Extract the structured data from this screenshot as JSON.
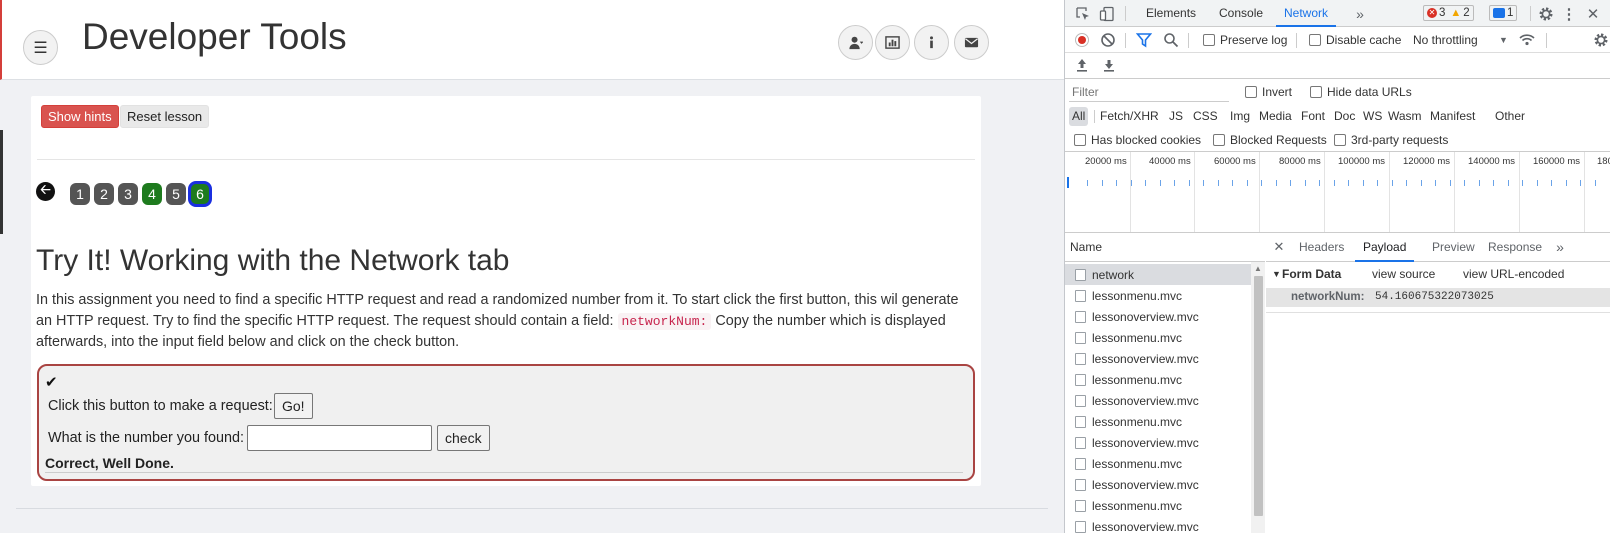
{
  "app": {
    "title": "Developer Tools"
  },
  "lesson": {
    "show_hints_label": "Show hints",
    "reset_label": "Reset lesson",
    "pages": [
      "1",
      "2",
      "3",
      "4",
      "5",
      "6"
    ],
    "title": "Try It! Working with the Network tab",
    "description_part1": "In this assignment you need to find a specific HTTP request and read a randomized number from it. To start click the first button, this wil generate an HTTP request. Try to find the specific HTTP request. The request should contain a field:",
    "description_code": "networkNum:",
    "description_part2": "Copy the number which is displayed afterwards, into the input field below and click on the check button.",
    "request_label": "Click this button to make a request:",
    "go_label": "Go!",
    "number_label": "What is the number you found:",
    "number_value": "",
    "check_label": "check",
    "feedback": "Correct, Well Done."
  },
  "devtools": {
    "tabs": [
      "Elements",
      "Console",
      "Network"
    ],
    "active_tab": "Network",
    "errors_count": "3",
    "warnings_count": "2",
    "messages_count": "1",
    "preserve_log_label": "Preserve log",
    "disable_cache_label": "Disable cache",
    "throttling_label": "No throttling",
    "filter_placeholder": "Filter",
    "invert_label": "Invert",
    "hide_data_urls_label": "Hide data URLs",
    "types": [
      "All",
      "Fetch/XHR",
      "JS",
      "CSS",
      "Img",
      "Media",
      "Font",
      "Doc",
      "WS",
      "Wasm",
      "Manifest",
      "Other"
    ],
    "has_blocked_cookies_label": "Has blocked cookies",
    "blocked_requests_label": "Blocked Requests",
    "third_party_label": "3rd-party requests",
    "timeline_ticks": [
      "20000 ms",
      "40000 ms",
      "60000 ms",
      "80000 ms",
      "100000 ms",
      "120000 ms",
      "140000 ms",
      "160000 ms",
      "180"
    ],
    "name_header": "Name",
    "requests": [
      "network",
      "lessonmenu.mvc",
      "lessonoverview.mvc",
      "lessonmenu.mvc",
      "lessonoverview.mvc",
      "lessonmenu.mvc",
      "lessonoverview.mvc",
      "lessonmenu.mvc",
      "lessonoverview.mvc",
      "lessonmenu.mvc",
      "lessonoverview.mvc",
      "lessonmenu.mvc",
      "lessonoverview.mvc"
    ],
    "detail_tabs": [
      "Headers",
      "Payload",
      "Preview",
      "Response"
    ],
    "active_detail_tab": "Payload",
    "form_data_label": "Form Data",
    "view_source_label": "view source",
    "view_url_encoded_label": "view URL-encoded",
    "payload_key": "networkNum:",
    "payload_value": "54.160675322073025"
  },
  "colors": {
    "accent": "#1a73e8",
    "danger": "#d9534f",
    "success": "#1e7b1e"
  }
}
